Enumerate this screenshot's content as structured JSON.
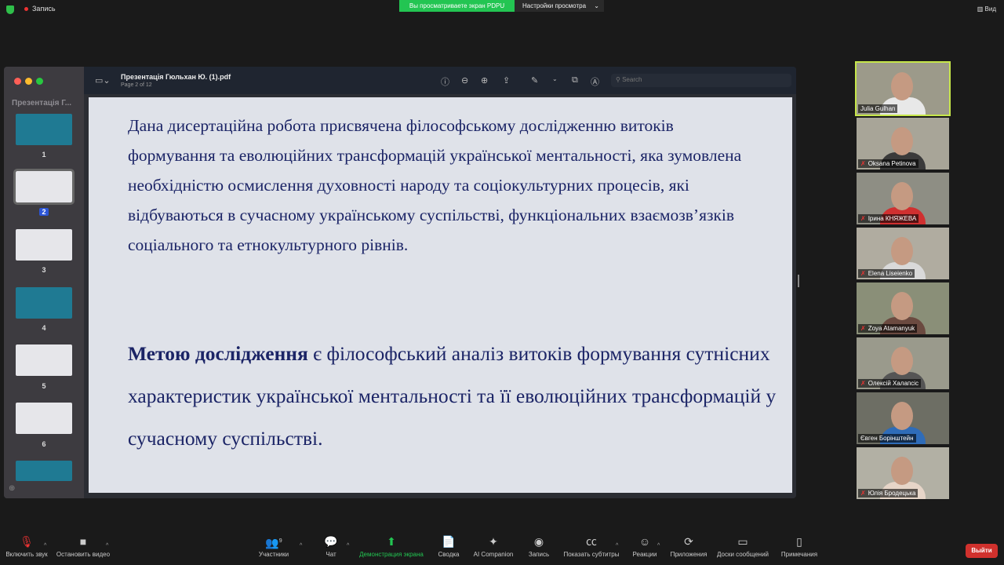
{
  "topbar": {
    "recording": "Запись",
    "viewing_banner": "Вы просматриваете экран PDPU",
    "view_settings": "Настройки просмотра",
    "view_button": "Вид"
  },
  "pdf": {
    "file_name": "Презентація Гюльхан Ю. (1).pdf",
    "page_info": "Page 2 of 12",
    "sidebar_title": "Презентація Г...",
    "search_placeholder": "Search",
    "selected_page": 2,
    "thumbnails": [
      "1",
      "2",
      "3",
      "4",
      "5",
      "6"
    ]
  },
  "slide": {
    "paragraph1": "Дана дисертаційна робота присвячена філософському дослідженню витоків формування та еволюційних трансформацій української ментальності, яка зумовлена необхідністю осмислення духовності народу та соціокультурних процесів, які відбуваються в сучасному українському суспільстві, функціональних взаємозв’язків соціального та етнокультурного рівнів.",
    "goal_bold": "Метою дослідження",
    "goal_rest": " є філософський аналіз витоків формування сутнісних характеристик української ментальності та її еволюційних трансформацій у сучасному суспільстві."
  },
  "participants": [
    {
      "name": "Julia Gulhan",
      "muted": false,
      "active": true
    },
    {
      "name": "Oksana Petinova",
      "muted": true
    },
    {
      "name": "Ірина КНЯЖЕВА",
      "muted": true
    },
    {
      "name": "Elena Liseienko",
      "muted": true
    },
    {
      "name": "Zoya Atamanyuk",
      "muted": true
    },
    {
      "name": "Олексій Халапсіс",
      "muted": true
    },
    {
      "name": "Євген Борінштейн",
      "muted": false
    },
    {
      "name": "Юлія Бродецька",
      "muted": true
    }
  ],
  "toolbar": {
    "unmute": "Включить звук",
    "stop_video": "Остановить видео",
    "participants": "Участники",
    "participants_count": "9",
    "chat": "Чат",
    "share": "Демонстрация экрана",
    "summary": "Сводка",
    "ai": "AI Companion",
    "record": "Запись",
    "captions": "Показать субтитры",
    "reactions": "Реакции",
    "apps": "Приложения",
    "whiteboards": "Доски сообщений",
    "notes": "Примечания",
    "leave": "Выйти"
  },
  "colors": {
    "share_green": "#23c552",
    "leave_red": "#d0312d",
    "slide_text": "#1b2466",
    "active_speaker": "#c6e64a"
  }
}
